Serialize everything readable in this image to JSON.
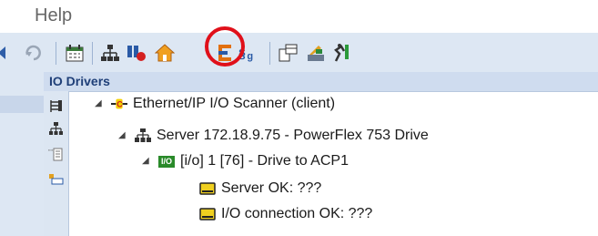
{
  "menu": {
    "help_label": "Help"
  },
  "toolbar": {
    "icons": [
      "back-arrow-icon",
      "refresh-icon",
      "calendar-icon",
      "network-icon",
      "variables-icon",
      "home-icon",
      "ladder-logic-icon",
      "script-icon",
      "layout-icon",
      "tools-icon",
      "runner-icon"
    ],
    "highlight_color": "#e0101a"
  },
  "panel": {
    "title": "IO Drivers"
  },
  "tree": {
    "node_scanner": {
      "label": "Ethernet/IP I/O Scanner (client)"
    },
    "node_server": {
      "label": "Server 172.18.9.75 - PowerFlex 753 Drive"
    },
    "node_io": {
      "badge": "I/O",
      "label": "[i/o] 1 [76] - Drive to ACP1"
    },
    "item_server_ok": {
      "label": "Server OK: ???"
    },
    "item_io_conn": {
      "label": "I/O connection OK: ???"
    }
  }
}
